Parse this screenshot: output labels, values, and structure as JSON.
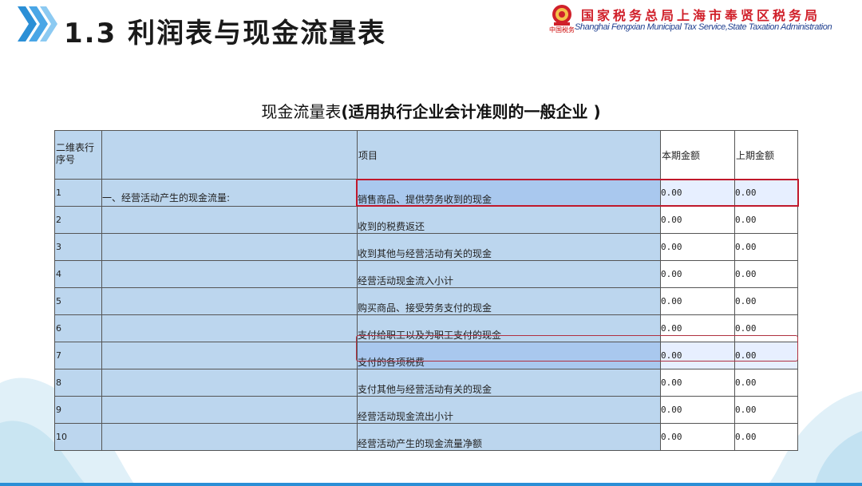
{
  "slide": {
    "title": "1.3 利润表与现金流量表"
  },
  "org": {
    "name_cn": "国家税务总局上海市奉贤区税务局",
    "name_en": "Shanghai Fengxian Municipal Tax Service,State Taxation Administration",
    "seal_text": "中国税务"
  },
  "table": {
    "title_plain": "现金流量表",
    "title_bold": "(适用执行企业会计准则的一般企业 )",
    "headers": {
      "index": "二维表行序号",
      "section": "",
      "item": "项目",
      "current": "本期金额",
      "previous": "上期金额"
    },
    "rows": [
      {
        "index": "1",
        "section": "一、经营活动产生的现金流量:",
        "item": "销售商品、提供劳务收到的现金",
        "current": "0.00",
        "previous": "0.00"
      },
      {
        "index": "2",
        "section": "",
        "item": "收到的税费返还",
        "current": "0.00",
        "previous": "0.00"
      },
      {
        "index": "3",
        "section": "",
        "item": "收到其他与经营活动有关的现金",
        "current": "0.00",
        "previous": "0.00"
      },
      {
        "index": "4",
        "section": "",
        "item": "经营活动现金流入小计",
        "current": "0.00",
        "previous": "0.00"
      },
      {
        "index": "5",
        "section": "",
        "item": "购买商品、接受劳务支付的现金",
        "current": "0.00",
        "previous": "0.00"
      },
      {
        "index": "6",
        "section": "",
        "item": "支付给职工以及为职工支付的现金",
        "current": "0.00",
        "previous": "0.00"
      },
      {
        "index": "7",
        "section": "",
        "item": "支付的各项税费",
        "current": "0.00",
        "previous": "0.00"
      },
      {
        "index": "8",
        "section": "",
        "item": "支付其他与经营活动有关的现金",
        "current": "0.00",
        "previous": "0.00"
      },
      {
        "index": "9",
        "section": "",
        "item": "经营活动现金流出小计",
        "current": "0.00",
        "previous": "0.00"
      },
      {
        "index": "10",
        "section": "",
        "item": "经营活动产生的现金流量净额",
        "current": "0.00",
        "previous": "0.00"
      }
    ],
    "highlighted_rows": [
      "1",
      "7"
    ]
  },
  "colors": {
    "accent_blue": "#2b8fd6",
    "cell_blue": "#bcd6ee",
    "highlight_red": "#c0182b",
    "org_red": "#d0202a",
    "org_navy": "#1f3f8f"
  }
}
